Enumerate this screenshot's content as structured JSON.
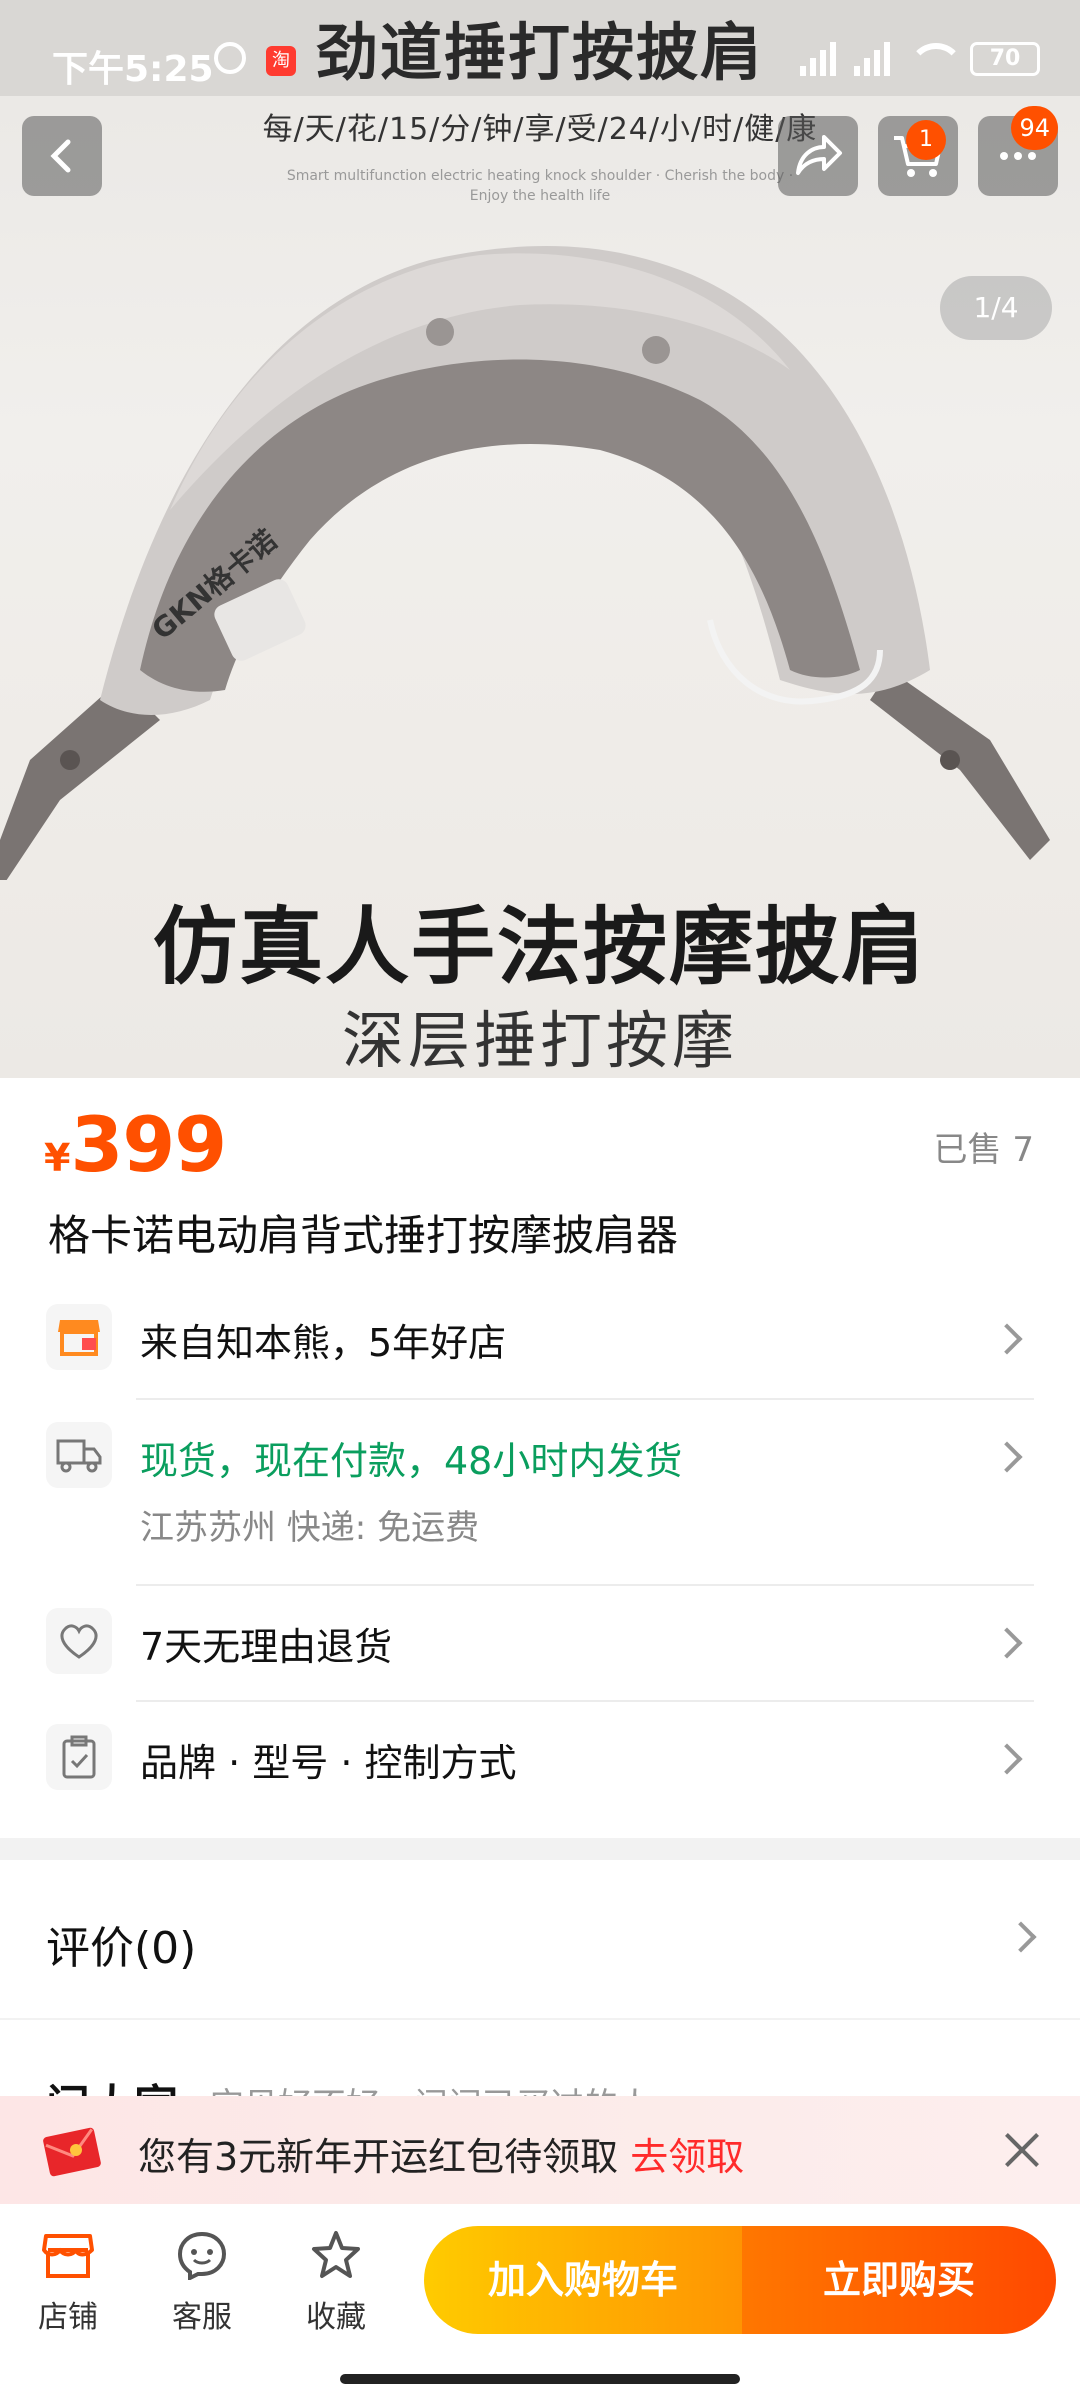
{
  "status_bar": {
    "time": "下午5:25",
    "taobao_badge": "淘",
    "battery": "70"
  },
  "hero": {
    "headline": "劲道捶打按披肩",
    "subline": "每/天/花/15/分/钟/享/受/24/小/时/健/康",
    "fine_print": "Smart multifunction electric heating knock shoulder · Cherish the body · Enjoy the health life",
    "caption_main": "仿真人手法按摩披肩",
    "caption_sub": "深层捶打按摩",
    "device_logo": "GKN格卡诺",
    "pager": "1/4"
  },
  "top_actions": {
    "cart_badge": "1",
    "more_badge": "94"
  },
  "product": {
    "currency": "¥",
    "price": "399",
    "sold": "已售 7",
    "title": "格卡诺电动肩背式捶打按摩披肩器"
  },
  "info_rows": [
    {
      "label": "来自知本熊，5年好店",
      "icon": "store-icon"
    },
    {
      "label": "现货，现在付款，48小时内发货",
      "sub": "江苏苏州  快递: 免运费",
      "icon": "truck-icon",
      "color": "#0a9e5e"
    },
    {
      "label": "7天无理由退货",
      "icon": "heart-icon"
    },
    {
      "label": "品牌 · 型号 · 控制方式",
      "icon": "clipboard-icon"
    }
  ],
  "reviews": {
    "title": "评价(0)"
  },
  "qa": {
    "title": "问大家",
    "subtitle": "宝贝好不好，问问已买过的人"
  },
  "promo": {
    "text": "您有3元新年开运红包待领取",
    "link": "去领取"
  },
  "bottom_bar": {
    "store": "店铺",
    "service": "客服",
    "favorite": "收藏",
    "add_to_cart": "加入购物车",
    "buy_now": "立即购买"
  },
  "colors": {
    "accent": "#ff5000",
    "green": "#0a9e5e",
    "cart_gradient_start": "#ffcb00",
    "buy_gradient_end": "#ff4900"
  }
}
